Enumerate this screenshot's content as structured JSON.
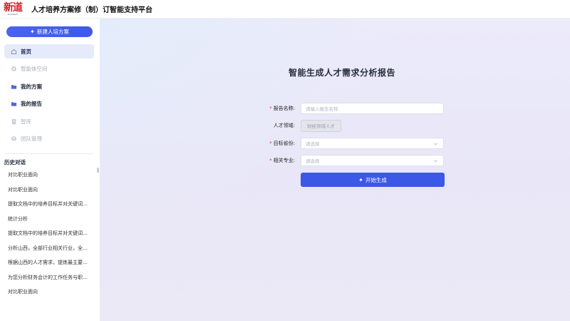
{
  "header": {
    "logo_text": "新道",
    "logo_sub": "xinedtech",
    "title": "人才培养方案修（制）订智能支持平台"
  },
  "sidebar": {
    "new_button_label": "新建人培方案",
    "nav_items": [
      {
        "label": "首页",
        "icon": "home-icon"
      },
      {
        "label": "智能体空间",
        "icon": "agent-icon"
      },
      {
        "label": "我的方案",
        "icon": "folder-icon"
      },
      {
        "label": "我的报告",
        "icon": "folder-icon"
      },
      {
        "label": "智库",
        "icon": "document-icon"
      },
      {
        "label": "团队管理",
        "icon": "team-icon"
      }
    ],
    "history_title": "历史对话",
    "history": [
      "对比职业面向",
      "对比职业面向",
      "提取文档中的培养目标并对关键词进行统计分析",
      "统计分析",
      "提取文档中的培养目标并对关键词进行统计分析",
      "分析山西，全部行业相关行业，全部职业",
      "根据山西的人才需求，提炼最主要的人才需求",
      "为您分析财务会计的工作任务与职业能力",
      "对比职业面向"
    ]
  },
  "main": {
    "title": "智能生成人才需求分析报告",
    "form": {
      "report_name_label": "报告名称:",
      "report_name_placeholder": "请输入报告名称",
      "talent_field_label": "人才领域:",
      "talent_field_value": "财经领域人才",
      "province_label": "目标省份:",
      "province_placeholder": "请选择",
      "major_label": "相关专业:",
      "major_placeholder": "请选择",
      "submit_label": "开始生成"
    }
  },
  "colors": {
    "accent": "#3c58e6",
    "brand_red": "#d41e26",
    "required": "#e23b3b"
  }
}
